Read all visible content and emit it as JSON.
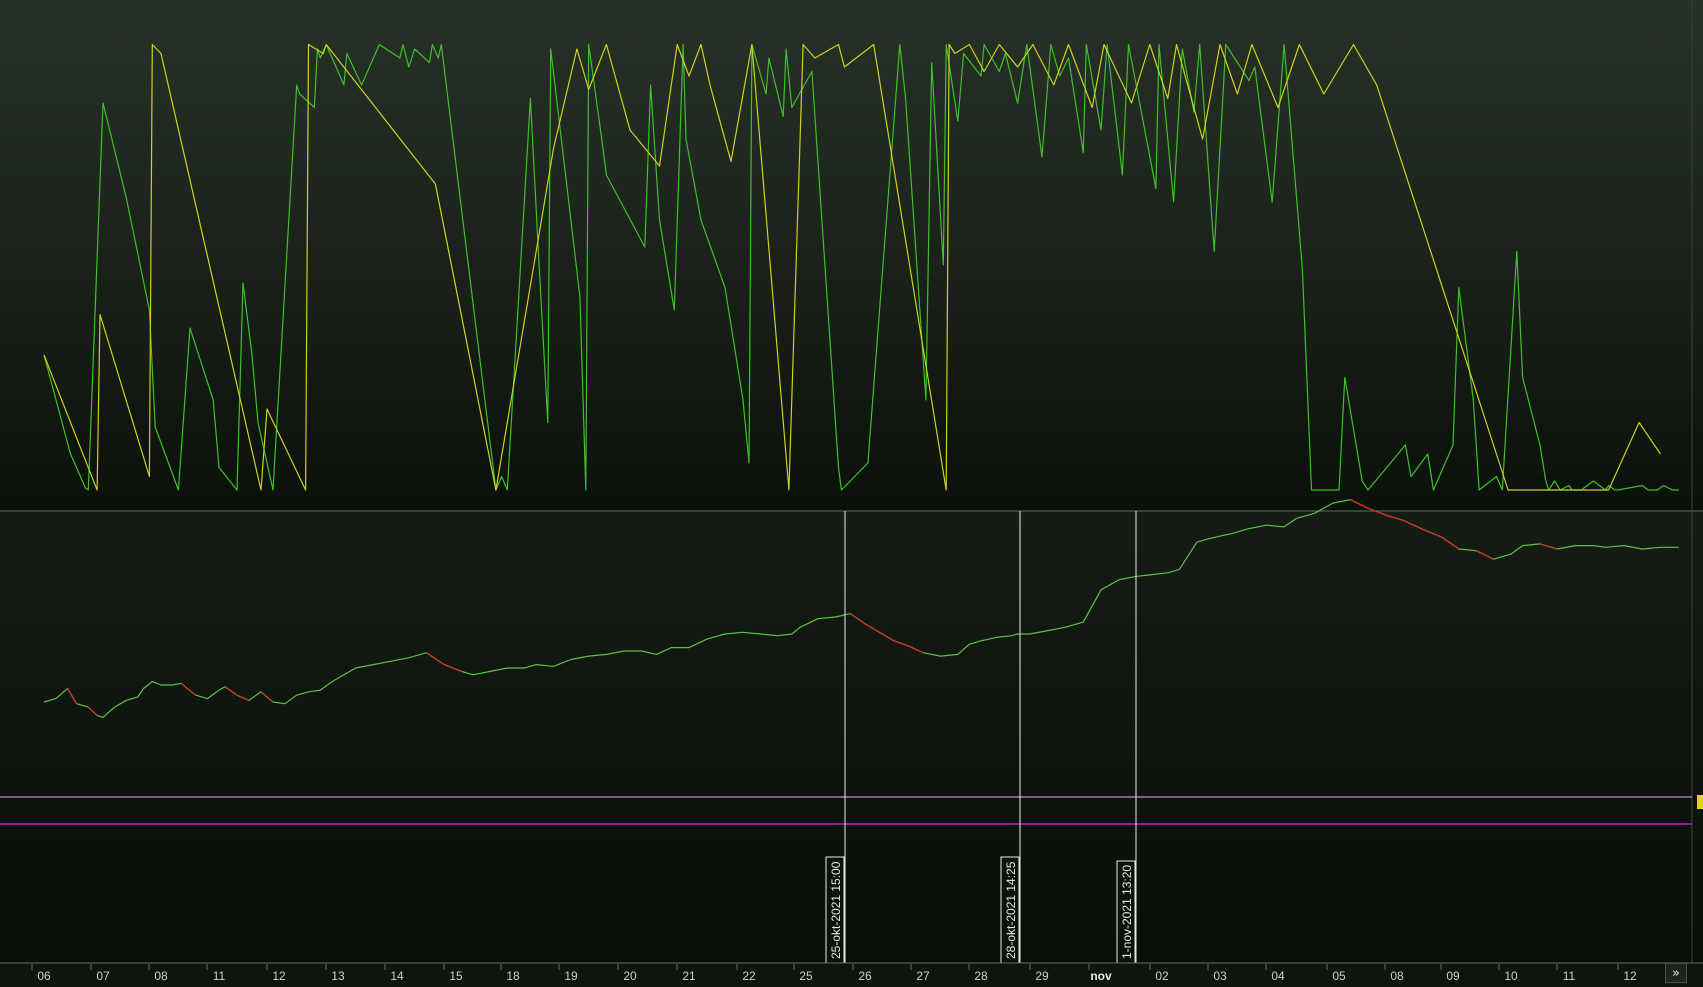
{
  "colors": {
    "background_top": "#283128",
    "background_bottom": "#0a110a",
    "separator": "#5f6e5f",
    "axis_text": "#c9d2c9",
    "oscillator_green": "#3fbf2a",
    "oscillator_yellow": "#cfd11f",
    "price_up": "#5fbf45",
    "price_down": "#d4322a",
    "marker_line": "#e8ece8",
    "level_line_light": "#e3b3f0",
    "level_line_magenta": "#c21cc9",
    "price_tag": "#e5d21c"
  },
  "navigation": {
    "scroll_right_icon": "double-chevron-right-icon",
    "scroll_right_label": "»"
  },
  "markers": [
    {
      "label": "25-okt-2021 15:00"
    },
    {
      "label": "28-okt-2021 14:25"
    },
    {
      "label": "1-nov-2021 13:20"
    }
  ],
  "chart_data": [
    {
      "type": "line",
      "name": "oscillator-pane",
      "x_labels": [
        "06",
        "07",
        "08",
        "11",
        "12",
        "13",
        "14",
        "15",
        "18",
        "19",
        "20",
        "21",
        "22",
        "25",
        "26",
        "27",
        "28",
        "29",
        "nov",
        "02",
        "03",
        "04",
        "05",
        "08",
        "09",
        "10",
        "11",
        "12"
      ],
      "ylim": [
        0,
        10
      ],
      "series": [
        {
          "color": "#3fbf2a",
          "x": [
            0,
            0.45,
            0.55,
            0.7,
            0.75,
            1.0,
            1.4,
            1.8,
            1.9,
            2.3,
            2.5,
            2.9,
            3.0,
            3.3,
            3.4,
            3.55,
            3.65,
            3.9,
            4.3,
            4.35,
            4.6,
            4.65,
            4.7,
            4.8,
            5.1,
            5.15,
            5.4,
            5.7,
            6.05,
            6.1,
            6.2,
            6.3,
            6.55,
            6.6,
            6.7,
            6.75,
            7.7,
            7.8,
            7.9,
            8.3,
            8.45,
            8.6,
            8.65,
            9.15,
            9.25,
            9.3,
            9.5,
            9.6,
            10.25,
            10.35,
            10.5,
            10.75,
            10.9,
            10.95,
            11.2,
            11.6,
            11.9,
            12.0,
            12.05,
            12.3,
            12.35,
            12.6,
            12.65,
            12.75,
            13.1,
            13.55,
            13.6,
            14.05,
            14.6,
            14.7,
            15.05,
            15.15,
            15.35,
            15.4,
            15.6,
            15.7,
            16.0,
            16.05,
            16.3,
            16.4,
            16.6,
            16.75,
            17.0,
            17.15,
            17.3,
            17.45,
            17.7,
            17.75,
            18.0,
            18.1,
            18.35,
            18.45,
            18.9,
            18.95,
            19.2,
            19.35,
            19.55,
            19.65,
            19.9,
            20.1,
            20.5,
            20.6,
            20.9,
            21.1,
            21.4,
            21.55,
            22.0,
            22.1,
            22.4,
            22.5,
            23.15,
            23.25,
            23.55,
            23.65,
            24.0,
            24.1,
            24.35,
            24.45,
            24.75,
            24.85,
            25.1,
            25.2,
            25.5,
            25.6,
            25.65,
            25.75,
            25.85,
            26.0,
            26.05,
            26.2,
            26.4,
            26.6,
            26.65,
            26.75,
            26.8,
            27.2,
            27.3,
            27.45,
            27.55,
            27.7,
            27.8
          ],
          "y": [
            3.0,
            0.8,
            0.5,
            0.05,
            0.0,
            8.6,
            6.5,
            4.0,
            1.4,
            0.0,
            3.6,
            2.0,
            0.5,
            0.0,
            4.6,
            3.0,
            1.5,
            0.0,
            9.0,
            8.8,
            8.5,
            9.8,
            9.6,
            9.9,
            9.0,
            9.7,
            9.0,
            9.9,
            9.6,
            9.9,
            9.4,
            9.8,
            9.5,
            9.9,
            9.6,
            9.9,
            0.0,
            0.3,
            0.0,
            8.7,
            5.0,
            1.5,
            9.8,
            4.3,
            0.0,
            9.9,
            8.0,
            7.0,
            5.4,
            9.0,
            6.0,
            4.0,
            9.9,
            7.8,
            6.0,
            4.5,
            2.0,
            0.6,
            9.9,
            8.8,
            9.6,
            8.3,
            9.8,
            8.5,
            9.3,
            0.5,
            0.0,
            0.6,
            9.9,
            8.7,
            2.0,
            9.5,
            5.0,
            9.9,
            8.2,
            9.7,
            9.2,
            9.9,
            9.3,
            9.7,
            8.6,
            9.9,
            7.4,
            9.9,
            9.2,
            9.6,
            7.5,
            9.9,
            8.0,
            9.9,
            7.0,
            9.9,
            6.7,
            9.9,
            6.4,
            9.8,
            8.4,
            9.9,
            5.3,
            9.9,
            9.1,
            9.4,
            6.4,
            9.9,
            4.9,
            0.0,
            0.0,
            2.5,
            0.2,
            0.0,
            1.0,
            0.3,
            0.8,
            0.0,
            1.0,
            4.5,
            2.0,
            0.0,
            0.3,
            0.0,
            5.3,
            2.5,
            1.0,
            0.2,
            0.0,
            0.2,
            0.0,
            0.1,
            0.0,
            0.0,
            0.2,
            0.0,
            0.1,
            0.0,
            0.0,
            0.1,
            0.0,
            0.0,
            0.1,
            0.0,
            0.0
          ]
        },
        {
          "color": "#cfd11f",
          "x": [
            0,
            0.9,
            0.95,
            1.8,
            1.85,
            2.0,
            3.7,
            3.8,
            4.45,
            4.5,
            4.75,
            4.8,
            6.65,
            7.7,
            8.7,
            9.1,
            9.3,
            9.6,
            10.0,
            10.5,
            10.8,
            11.0,
            11.2,
            11.35,
            11.7,
            12.05,
            12.7,
            12.95,
            13.15,
            13.55,
            13.65,
            14.15,
            15.4,
            15.45,
            15.55,
            15.8,
            16.05,
            16.3,
            16.6,
            16.85,
            17.2,
            17.45,
            17.85,
            18.05,
            18.5,
            18.8,
            19.1,
            19.25,
            19.7,
            20.0,
            20.3,
            20.55,
            21.0,
            21.35,
            21.75,
            22.25,
            22.65,
            24.95,
            25.45,
            25.7,
            25.95,
            26.15,
            26.3,
            26.65,
            27.15,
            27.5
          ],
          "y": [
            3.0,
            0.0,
            3.9,
            0.3,
            9.9,
            9.7,
            0.0,
            1.8,
            0.0,
            9.9,
            9.7,
            9.9,
            6.8,
            0.0,
            7.6,
            9.8,
            8.9,
            9.9,
            8.0,
            7.2,
            9.9,
            9.2,
            9.9,
            9.0,
            7.3,
            9.9,
            0.0,
            9.9,
            9.6,
            9.9,
            9.4,
            9.9,
            0.0,
            9.9,
            9.7,
            9.9,
            9.3,
            9.9,
            9.4,
            9.9,
            9.0,
            9.9,
            8.5,
            9.9,
            8.6,
            9.9,
            8.7,
            9.9,
            7.8,
            9.9,
            8.8,
            9.9,
            8.5,
            9.9,
            8.8,
            9.9,
            9.0,
            0.0,
            0.0,
            0.0,
            0.0,
            0.0,
            0.0,
            0.0,
            1.5,
            0.8
          ]
        }
      ]
    },
    {
      "type": "line",
      "name": "price-pane",
      "x_labels": [
        "06",
        "07",
        "08",
        "11",
        "12",
        "13",
        "14",
        "15",
        "18",
        "19",
        "20",
        "21",
        "22",
        "25",
        "26",
        "27",
        "28",
        "29",
        "nov",
        "02",
        "03",
        "04",
        "05",
        "08",
        "09",
        "10",
        "11",
        "12"
      ],
      "ylim": [
        0,
        10
      ],
      "series": [
        {
          "color": "#5fbf45",
          "x": [
            0,
            0.2,
            0.4,
            0.55,
            0.75,
            0.9,
            1.0,
            1.2,
            1.4,
            1.6,
            1.7,
            1.85,
            2.0,
            2.2,
            2.35,
            2.45,
            2.6,
            2.8,
            3.0,
            3.1,
            3.3,
            3.5,
            3.7,
            3.9,
            4.1,
            4.3,
            4.5,
            4.7,
            4.9,
            5.1,
            5.3,
            5.6,
            5.9,
            6.2,
            6.5,
            6.8,
            7.1,
            7.3,
            7.6,
            7.9,
            8.2,
            8.4,
            8.7,
            9.0,
            9.3,
            9.6,
            9.9,
            10.2,
            10.45,
            10.7,
            11.0,
            11.3,
            11.6,
            11.9,
            12.2,
            12.5,
            12.75,
            12.9,
            13.2,
            13.5,
            13.75,
            14.0,
            14.25,
            14.5,
            14.75,
            15.0,
            15.3,
            15.6,
            15.8,
            16.0,
            16.25,
            16.5,
            16.6,
            16.8,
            17.1,
            17.4,
            17.7,
            18.0,
            18.3,
            18.6,
            18.85,
            19.1,
            19.3,
            19.6,
            19.8,
            20.05,
            20.2,
            20.5,
            20.8,
            21.1,
            21.3,
            21.6,
            21.9,
            22.2,
            22.5,
            22.8,
            23.1,
            23.5,
            23.8,
            24.1,
            24.4,
            24.7,
            25.0,
            25.2,
            25.5,
            25.8,
            26.1,
            26.4,
            26.6,
            26.9,
            27.2,
            27.5,
            27.8
          ],
          "y": [
            7.0,
            7.1,
            7.4,
            6.95,
            6.85,
            6.6,
            6.55,
            6.85,
            7.05,
            7.15,
            7.4,
            7.6,
            7.5,
            7.5,
            7.55,
            7.4,
            7.2,
            7.1,
            7.35,
            7.45,
            7.2,
            7.05,
            7.3,
            7.0,
            6.95,
            7.2,
            7.3,
            7.35,
            7.6,
            7.8,
            8.0,
            8.1,
            8.2,
            8.3,
            8.45,
            8.1,
            7.9,
            7.8,
            7.9,
            8.0,
            8.0,
            8.1,
            8.05,
            8.25,
            8.35,
            8.4,
            8.5,
            8.5,
            8.4,
            8.6,
            8.6,
            8.85,
            9.0,
            9.05,
            9.0,
            8.95,
            9.0,
            9.2,
            9.45,
            9.5,
            9.6,
            9.3,
            9.05,
            8.8,
            8.65,
            8.45,
            8.35,
            8.4,
            8.7,
            8.8,
            8.9,
            8.95,
            9.0,
            9.0,
            9.1,
            9.2,
            9.35,
            10.3,
            10.6,
            10.7,
            10.75,
            10.8,
            10.9,
            11.7,
            11.8,
            11.9,
            11.95,
            12.1,
            12.2,
            12.15,
            12.4,
            12.55,
            12.85,
            12.95,
            12.7,
            12.5,
            12.35,
            12.05,
            11.85,
            11.5,
            11.45,
            11.2,
            11.35,
            11.6,
            11.65,
            11.5,
            11.6,
            11.6,
            11.55,
            11.6,
            11.5,
            11.55,
            11.55
          ]
        }
      ],
      "annotations": [
        "25-okt-2021 15:00",
        "28-okt-2021 14:25",
        "1-nov-2021 13:20"
      ]
    }
  ]
}
